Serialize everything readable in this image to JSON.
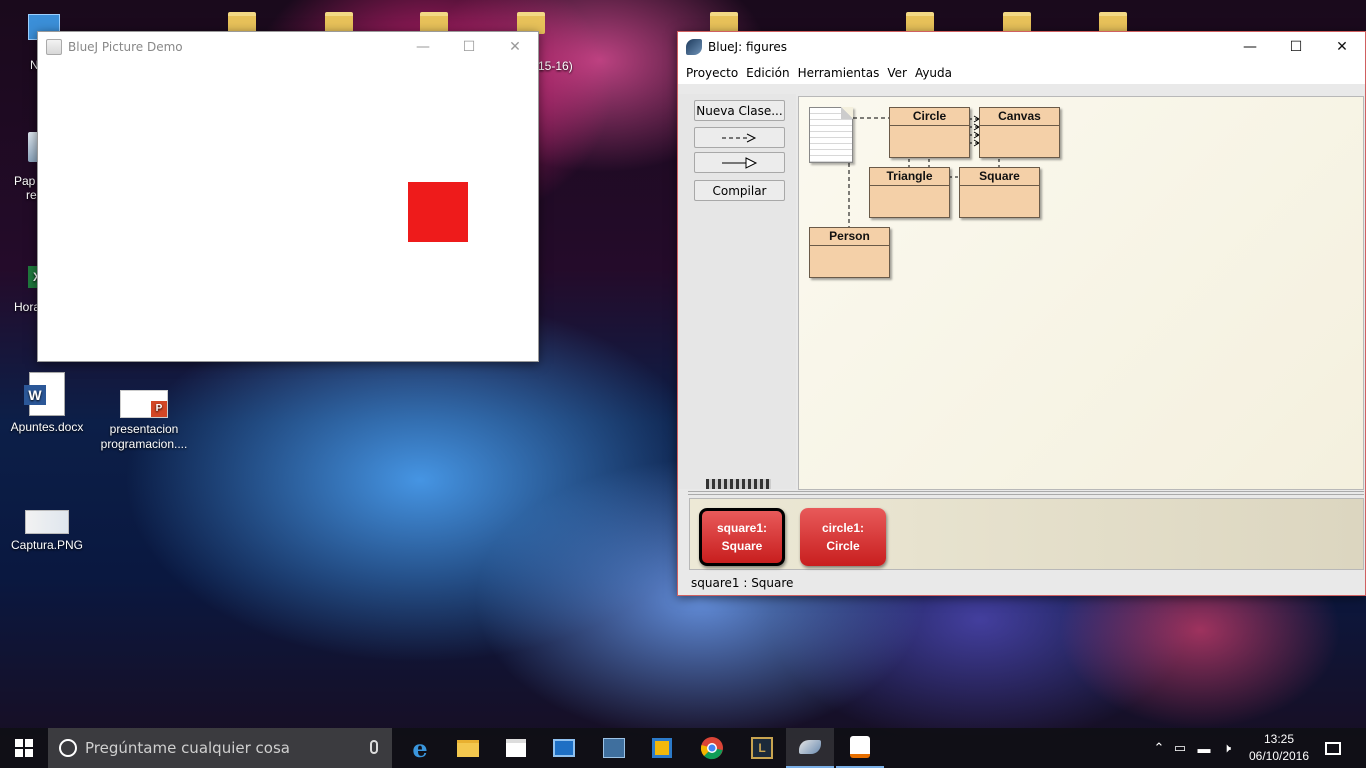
{
  "desktop": {
    "icons": [
      {
        "label": "N"
      },
      {
        "label": "Pap"
      },
      {
        "label": "re"
      },
      {
        "label": "Hora"
      },
      {
        "label": "Apuntes.docx"
      },
      {
        "label": "presentacion programacion...."
      },
      {
        "label": "Captura.PNG"
      }
    ],
    "partial_label": "15-16)"
  },
  "picture_window": {
    "title": "BlueJ Picture Demo",
    "square_color": "#ee1b1b"
  },
  "bluej_window": {
    "title": "BlueJ:  figures",
    "menu": [
      "Proyecto",
      "Edición",
      "Herramientas",
      "Ver",
      "Ayuda"
    ],
    "buttons": {
      "new_class": "Nueva Clase...",
      "compile": "Compilar"
    },
    "classes": [
      "Circle",
      "Canvas",
      "Triangle",
      "Square",
      "Person"
    ],
    "objects": [
      {
        "name": "square1:",
        "type": "Square",
        "selected": true
      },
      {
        "name": "circle1:",
        "type": "Circle",
        "selected": false
      }
    ],
    "status": "square1 : Square"
  },
  "taskbar": {
    "search_placeholder": "Pregúntame cualquier cosa",
    "time": "13:25",
    "date": "06/10/2016"
  }
}
